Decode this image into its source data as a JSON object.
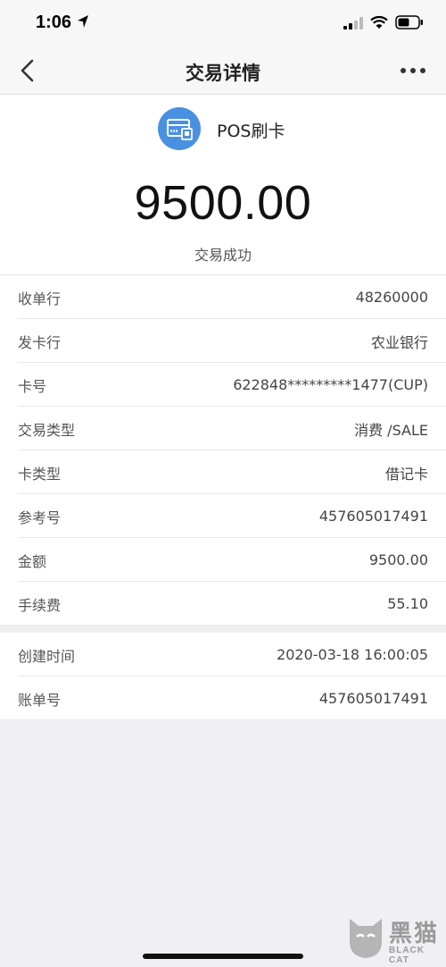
{
  "status_bar": {
    "time": "1:06"
  },
  "nav": {
    "title": "交易详情"
  },
  "header": {
    "icon": "card-icon",
    "method_label": "POS刷卡",
    "amount": "9500.00",
    "status": "交易成功",
    "accent_color": "#4a90e2"
  },
  "details": [
    {
      "label": "收单行",
      "value": "48260000"
    },
    {
      "label": "发卡行",
      "value": "农业银行"
    },
    {
      "label": "卡号",
      "value": "622848*********1477(CUP)"
    },
    {
      "label": "交易类型",
      "value": "消费 /SALE"
    },
    {
      "label": "卡类型",
      "value": "借记卡"
    },
    {
      "label": "参考号",
      "value": "457605017491"
    },
    {
      "label": "金额",
      "value": "9500.00"
    },
    {
      "label": "手续费",
      "value": "55.10"
    }
  ],
  "extra": [
    {
      "label": "创建时间",
      "value": "2020-03-18 16:00:05"
    },
    {
      "label": "账单号",
      "value": "457605017491"
    }
  ],
  "watermark": {
    "main": "黑猫",
    "sub": "BLACK CAT"
  }
}
